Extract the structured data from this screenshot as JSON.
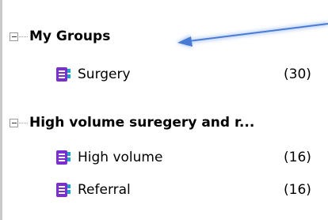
{
  "groups": [
    {
      "title": "My Groups",
      "toggle_icon": "collapse-minus-icon",
      "items": [
        {
          "label": "Surgery",
          "count": "(30)",
          "icon": "notebook-icon"
        }
      ]
    },
    {
      "title": "High volume suregery and r...",
      "toggle_icon": "collapse-minus-icon",
      "items": [
        {
          "label": "High volume",
          "count": "(16)",
          "icon": "notebook-icon"
        },
        {
          "label": "Referral",
          "count": "(16)",
          "icon": "notebook-icon"
        }
      ]
    }
  ],
  "annotation": {
    "icon": "arrow-icon",
    "color": "#4a7bd4"
  },
  "colors": {
    "icon_purple": "#7b2fd0",
    "icon_teal": "#1aa6c8"
  }
}
